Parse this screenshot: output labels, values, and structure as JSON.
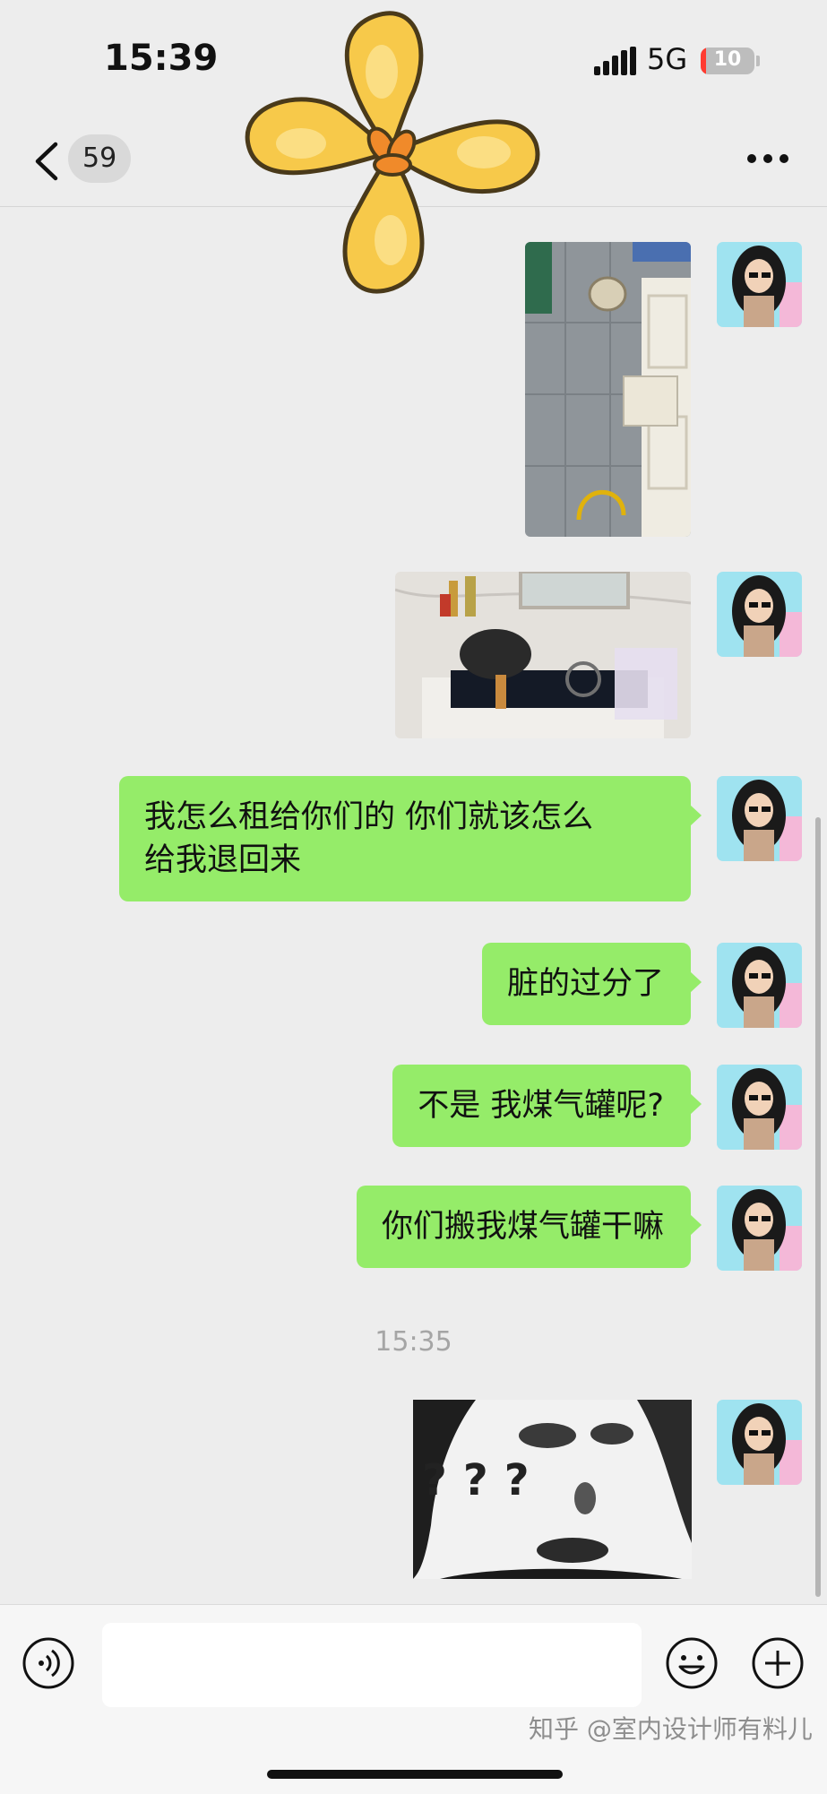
{
  "status_bar": {
    "time": "15:39",
    "network": "5G",
    "battery": "10",
    "battery_level_percent": 10
  },
  "nav": {
    "unread_count": "59",
    "back_icon": "chevron-left-icon",
    "more_icon": "more-dots-icon"
  },
  "colors": {
    "background": "#ededed",
    "bubble": "#95ec69",
    "battery_low": "#ff3b30"
  },
  "messages": [
    {
      "kind": "image",
      "subject": "kitchen-floor-photo"
    },
    {
      "kind": "image",
      "subject": "stove-photo"
    },
    {
      "kind": "text",
      "text": "我怎么租给你们的 你们就该怎么\n给我退回来"
    },
    {
      "kind": "text",
      "text": "脏的过分了"
    },
    {
      "kind": "text",
      "text": "不是 我煤气罐呢?"
    },
    {
      "kind": "text",
      "text": "你们搬我煤气罐干嘛"
    },
    {
      "kind": "timestamp",
      "text": "15:35"
    },
    {
      "kind": "sticker",
      "text": "???"
    }
  ],
  "input_bar": {
    "value": "",
    "voice_icon": "voice-icon",
    "emoji_icon": "emoji-icon",
    "plus_icon": "plus-icon",
    "watermark": "知乎 @室内设计师有料儿"
  }
}
